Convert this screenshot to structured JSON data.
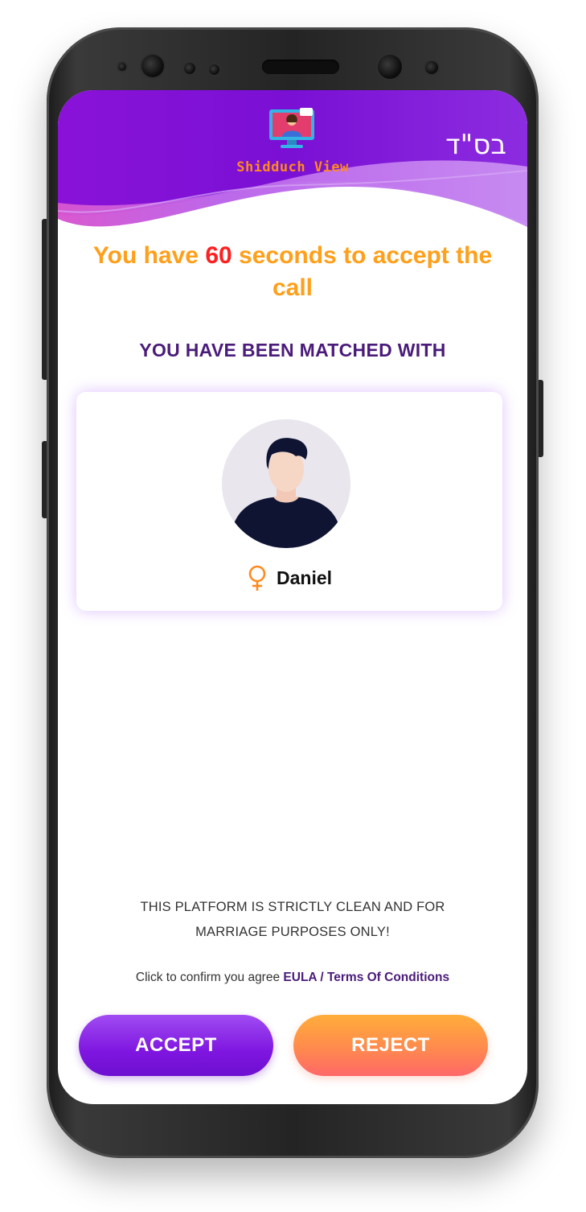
{
  "header": {
    "brand_name": "Shidduch View",
    "hebrew_text": "בס\"ד",
    "logo_icon": "video-monitor-logo-icon"
  },
  "countdown": {
    "prefix": "You have ",
    "seconds": "60",
    "suffix": " seconds to accept the call"
  },
  "match": {
    "heading": "YOU HAVE BEEN MATCHED WITH",
    "name": "Daniel",
    "gender_icon": "female-symbol-icon",
    "avatar_icon": "person-avatar-icon"
  },
  "footer": {
    "disclaimer_line1": "THIS PLATFORM IS STRICTLY CLEAN AND FOR",
    "disclaimer_line2": "MARRIAGE PURPOSES ONLY!",
    "agree_text": "Click to confirm you agree ",
    "agree_link": "EULA / Terms Of Conditions"
  },
  "actions": {
    "accept_label": "ACCEPT",
    "reject_label": "REJECT"
  },
  "colors": {
    "header_purple": "#7b0fd6",
    "countdown_orange": "#ff9f1a",
    "countdown_seconds_red": "#ff1f1f",
    "heading_purple": "#4a1b7a",
    "accept_gradient_start": "#a04cf2",
    "accept_gradient_end": "#6d0fd0",
    "reject_gradient_start": "#ffad3a",
    "reject_gradient_end": "#ff6868"
  }
}
